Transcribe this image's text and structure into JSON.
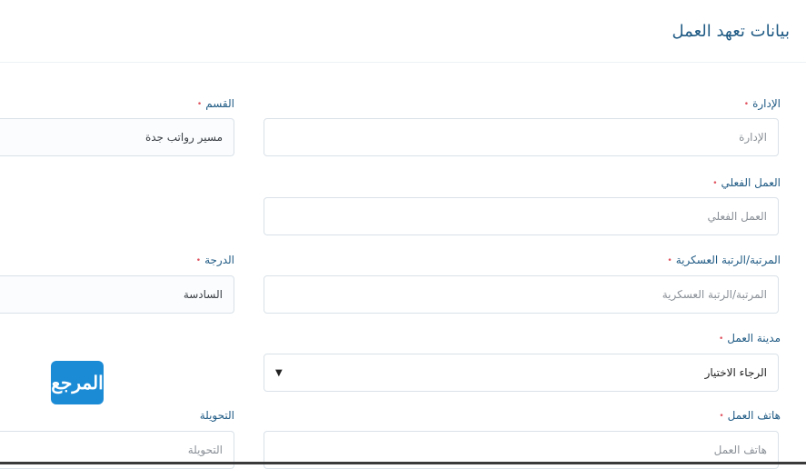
{
  "header": {
    "title": "بيانات تعهد العمل"
  },
  "fields": {
    "department": {
      "label": "الإدارة",
      "placeholder": "الإدارة"
    },
    "section": {
      "label": "القسم",
      "value": "مسير رواتب جدة"
    },
    "actual_work": {
      "label": "العمل الفعلي",
      "placeholder": "العمل الفعلي"
    },
    "rank": {
      "label": "المرتبة/الرتبة العسكرية",
      "placeholder": "المرتبة/الرتبة العسكرية"
    },
    "grade": {
      "label": "الدرجة",
      "value": "السادسة"
    },
    "work_city": {
      "label": "مدينة العمل",
      "selected": "الرجاء الاختيار",
      "arrow": "▼"
    },
    "work_phone": {
      "label": "هاتف العمل",
      "placeholder": "هاتف العمل"
    },
    "extension": {
      "label": "التحويلة",
      "placeholder": "التحويلة"
    }
  },
  "required_marker": "•",
  "watermark": {
    "text": "المرجع"
  }
}
